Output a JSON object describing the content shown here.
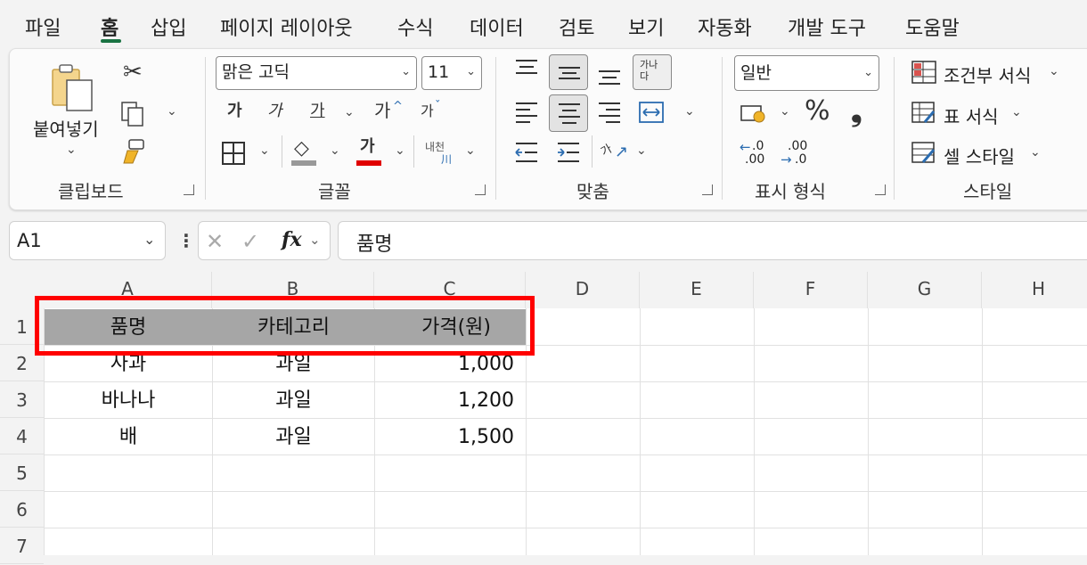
{
  "menu_tabs": [
    "파일",
    "홈",
    "삽입",
    "페이지 레이아웃",
    "수식",
    "데이터",
    "검토",
    "보기",
    "자동화",
    "개발 도구",
    "도움말"
  ],
  "active_tab": "홈",
  "ribbon": {
    "clipboard": {
      "paste_label": "붙여넣기",
      "group_label": "클립보드"
    },
    "font": {
      "font_name": "맑은 고딕",
      "font_size": "11",
      "bold_glyph": "가",
      "italic_glyph": "가",
      "underline_glyph": "가",
      "grow_glyph": "가",
      "shrink_glyph": "가",
      "font_color_glyph": "가",
      "phonetic_glyph": "내천",
      "group_label": "글꼴"
    },
    "alignment": {
      "wrap_glyph": "가나다",
      "orient_glyph": "가",
      "group_label": "맞춤"
    },
    "number": {
      "format": "일반",
      "percent_glyph": "%",
      "comma_glyph": "❟",
      "increase_decimal": ".00",
      "decrease_decimal": ".0",
      "group_label": "표시 형식"
    },
    "styles": {
      "conditional_label": "조건부 서식",
      "table_label": "표 서식",
      "cell_label": "셀 스타일",
      "group_label": "스타일"
    }
  },
  "formula_bar": {
    "name_box": "A1",
    "fx": "fx",
    "content": "품명"
  },
  "columns": [
    "A",
    "B",
    "C",
    "D",
    "E",
    "F",
    "G",
    "H"
  ],
  "rows": [
    "1",
    "2",
    "3",
    "4",
    "5",
    "6",
    "7"
  ],
  "table": {
    "headers": [
      "품명",
      "카테고리",
      "가격(원)"
    ],
    "rows": [
      [
        "사과",
        "과일",
        "1,000"
      ],
      [
        "바나나",
        "과일",
        "1,200"
      ],
      [
        "배",
        "과일",
        "1,500"
      ]
    ]
  },
  "colors": {
    "accent": "#1a7343",
    "header_fill": "#a6a6a6",
    "highlight": "#ff0000"
  }
}
